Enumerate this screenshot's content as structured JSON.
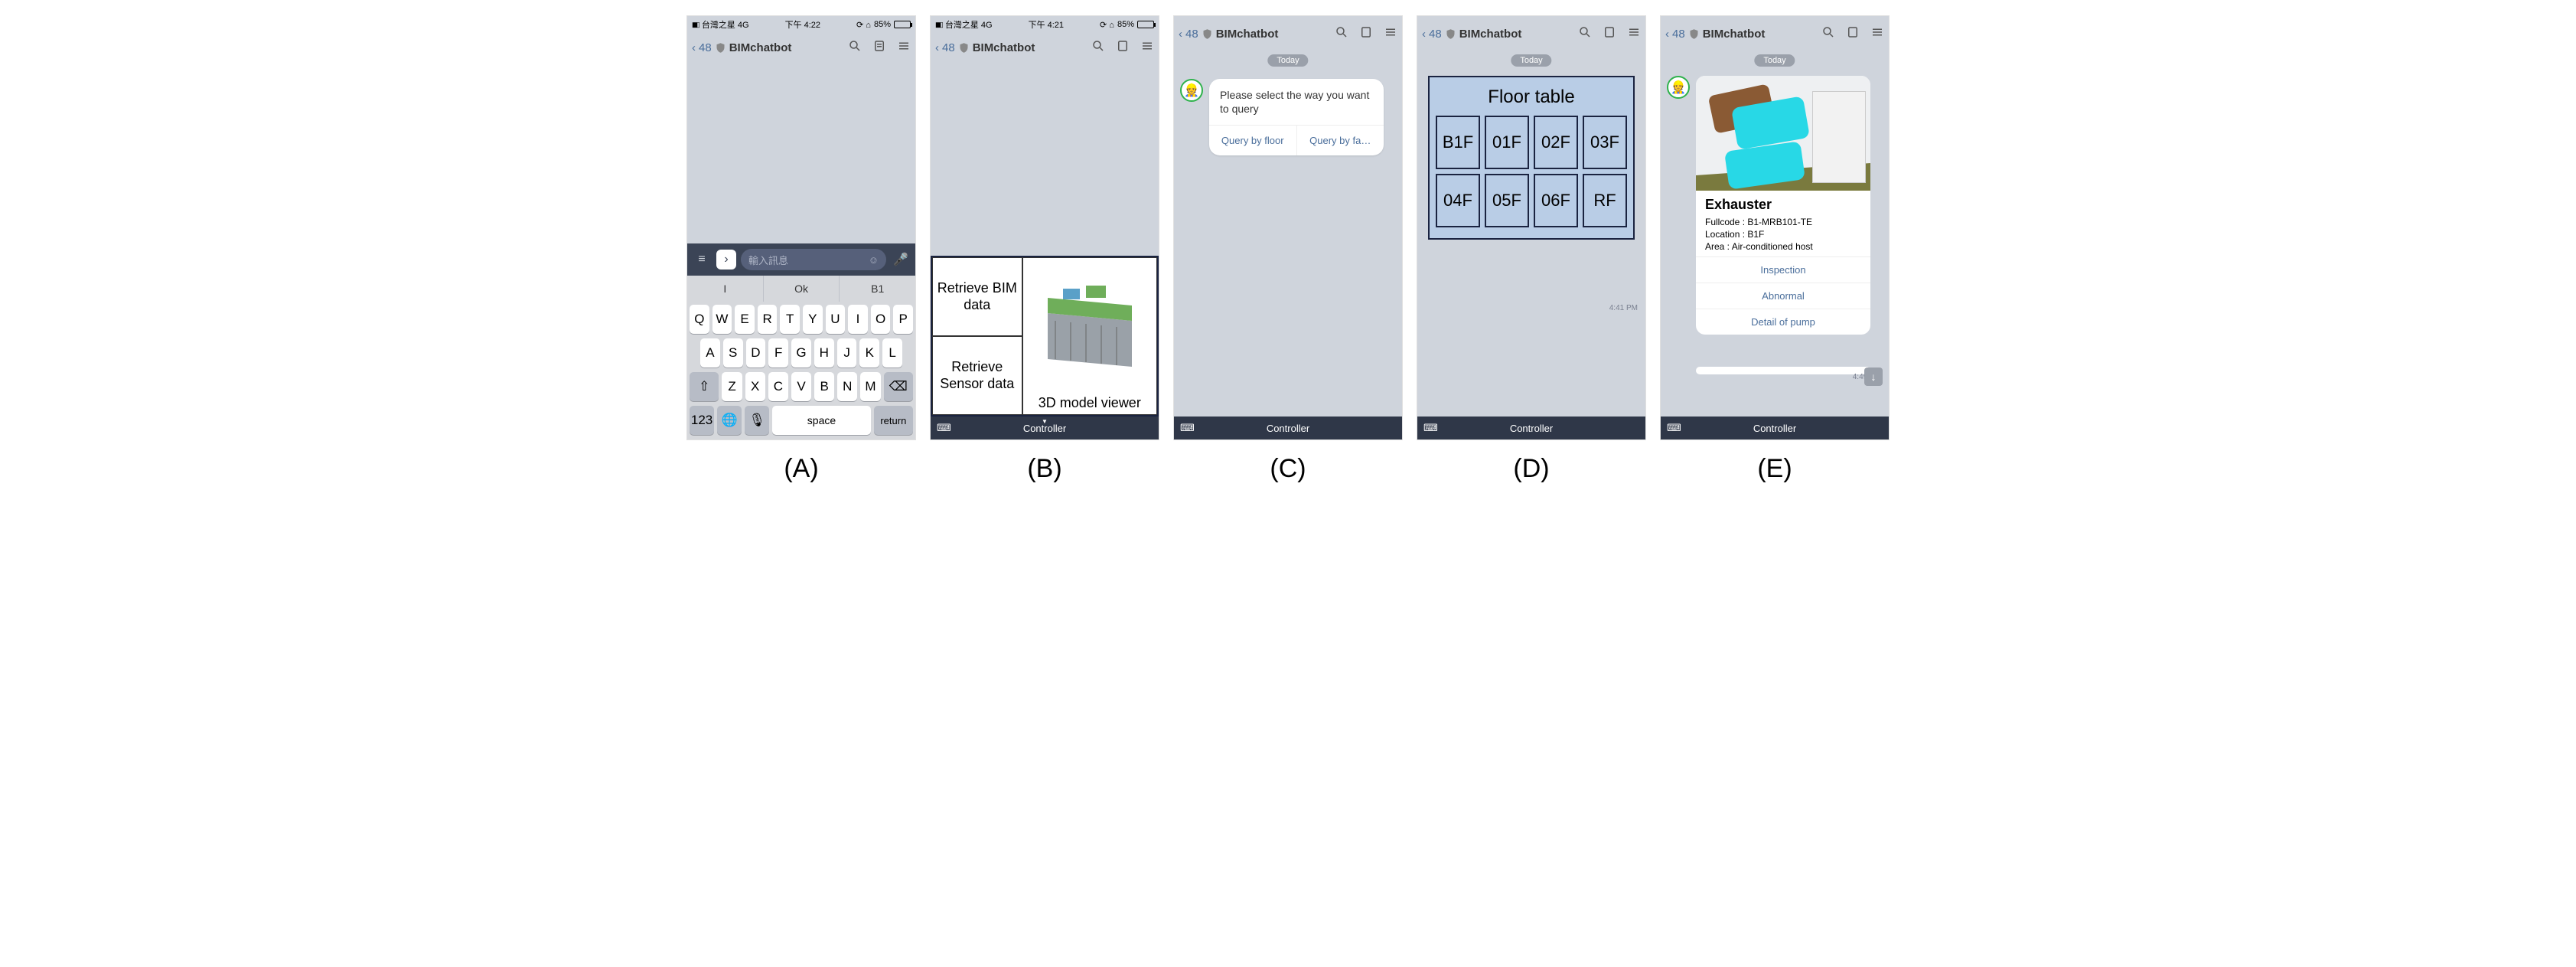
{
  "status": {
    "carrier": "台灣之星 4G",
    "timeA": "下午 4:22",
    "timeB": "下午 4:21",
    "indicators": "85%"
  },
  "nav": {
    "back": "48",
    "title": "BIMchatbot"
  },
  "input": {
    "placeholder": "輸入訊息"
  },
  "suggestions": [
    "I",
    "Ok",
    "B1"
  ],
  "keyboard": {
    "r1": [
      "Q",
      "W",
      "E",
      "R",
      "T",
      "Y",
      "U",
      "I",
      "O",
      "P"
    ],
    "r2": [
      "A",
      "S",
      "D",
      "F",
      "G",
      "H",
      "J",
      "K",
      "L"
    ],
    "r3": [
      "Z",
      "X",
      "C",
      "V",
      "B",
      "N",
      "M"
    ],
    "num": "123",
    "space": "space",
    "return": "return"
  },
  "richmenu": {
    "bim": "Retrieve BIM data",
    "sensor": "Retrieve Sensor data",
    "viewer": "3D model viewer"
  },
  "controller": "Controller",
  "today": "Today",
  "queryCard": {
    "msg": "Please select the way you want to query",
    "opt1": "Query by floor",
    "opt2": "Query by fa…"
  },
  "floorTable": {
    "title": "Floor table",
    "cells": [
      "B1F",
      "01F",
      "02F",
      "03F",
      "04F",
      "05F",
      "06F",
      "RF"
    ],
    "time": "4:41 PM"
  },
  "equipment": {
    "title": "Exhauster",
    "fullcode_label": "Fullcode : ",
    "fullcode": "B1-MRB101-TE",
    "location_label": "Location : ",
    "location": "B1F",
    "area_label": "Area : ",
    "area": "Air-conditioned host",
    "actions": [
      "Inspection",
      "Abnormal",
      "Detail of pump"
    ],
    "time": "4:49 PM"
  },
  "captions": {
    "a": "(A)",
    "b": "(B)",
    "c": "(C)",
    "d": "(D)",
    "e": "(E)"
  }
}
